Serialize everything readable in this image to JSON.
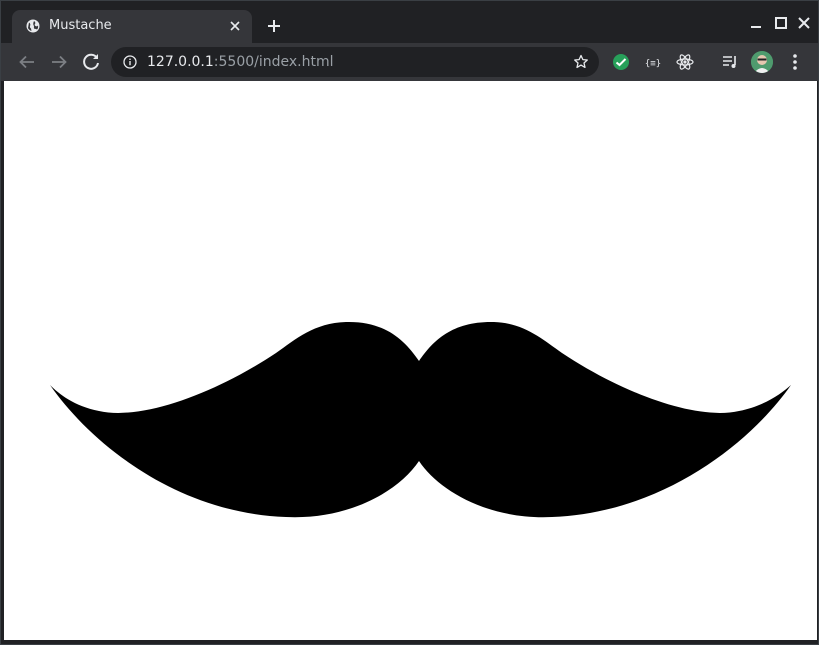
{
  "tab": {
    "title": "Mustache",
    "favicon": "globe-icon"
  },
  "toolbar": {
    "url_host": "127.0.0.1",
    "url_path": ":5500/index.html"
  },
  "icons": {
    "back": "arrow-left-icon",
    "forward": "arrow-right-icon",
    "reload": "reload-icon",
    "info": "info-icon",
    "bookmark": "star-icon",
    "menu": "kebab-menu-icon"
  },
  "colors": {
    "frame": "#202124",
    "toolbar": "#35363a",
    "page_background": "#ffffff",
    "mustache": "#000000"
  }
}
